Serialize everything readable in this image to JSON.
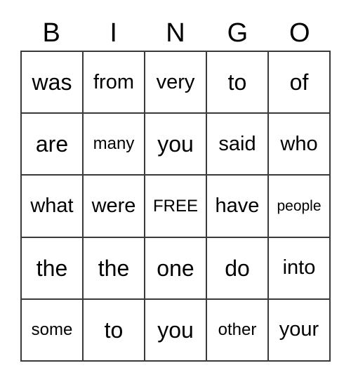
{
  "card": {
    "header": {
      "letters": [
        "B",
        "I",
        "N",
        "G",
        "O"
      ]
    },
    "columns": 5,
    "rows": 5,
    "free_space_label": "FREE",
    "free_space_position": {
      "row": 3,
      "column": 3
    },
    "colors": {
      "border": "#3a3a3a",
      "text": "#000000",
      "background": "#ffffff"
    },
    "grid": [
      [
        {
          "text": "was",
          "size": "size-lg"
        },
        {
          "text": "from",
          "size": "size-md"
        },
        {
          "text": "very",
          "size": "size-md"
        },
        {
          "text": "to",
          "size": "size-lg"
        },
        {
          "text": "of",
          "size": "size-lg"
        }
      ],
      [
        {
          "text": "are",
          "size": "size-lg"
        },
        {
          "text": "many",
          "size": "size-sm"
        },
        {
          "text": "you",
          "size": "size-lg"
        },
        {
          "text": "said",
          "size": "size-md"
        },
        {
          "text": "who",
          "size": "size-md"
        }
      ],
      [
        {
          "text": "what",
          "size": "size-md"
        },
        {
          "text": "were",
          "size": "size-md"
        },
        {
          "text": "FREE",
          "size": "size-sm"
        },
        {
          "text": "have",
          "size": "size-md"
        },
        {
          "text": "people",
          "size": "size-xs"
        }
      ],
      [
        {
          "text": "the",
          "size": "size-lg"
        },
        {
          "text": "the",
          "size": "size-lg"
        },
        {
          "text": "one",
          "size": "size-lg"
        },
        {
          "text": "do",
          "size": "size-lg"
        },
        {
          "text": "into",
          "size": "size-md"
        }
      ],
      [
        {
          "text": "some",
          "size": "size-sm"
        },
        {
          "text": "to",
          "size": "size-lg"
        },
        {
          "text": "you",
          "size": "size-lg"
        },
        {
          "text": "other",
          "size": "size-sm"
        },
        {
          "text": "your",
          "size": "size-md"
        }
      ]
    ]
  }
}
